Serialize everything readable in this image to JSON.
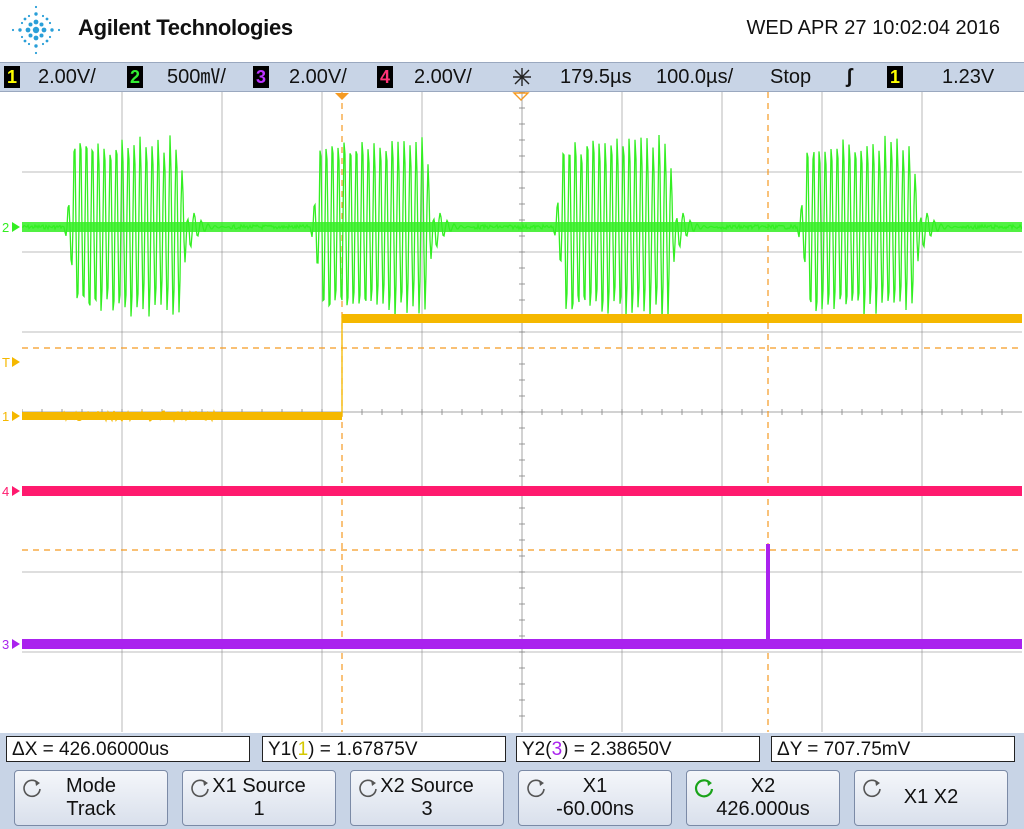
{
  "header": {
    "brand": "Agilent Technologies",
    "datetime": "WED APR 27 10:02:04 2016"
  },
  "status": {
    "ch1": {
      "num": "1",
      "scale": "2.00V/",
      "color": "#ffff00"
    },
    "ch2": {
      "num": "2",
      "scale": "500㎷/",
      "color": "#33ee33"
    },
    "ch3": {
      "num": "3",
      "scale": "2.00V/",
      "color": "#bb33ff"
    },
    "ch4": {
      "num": "4",
      "scale": "2.00V/",
      "color": "#ff3377"
    },
    "delay": "179.5µs",
    "timebase": "100.0µs/",
    "run_state": "Stop",
    "trigger_edge": "ʃ",
    "trigger_source": "1",
    "trigger_level": "1.23V"
  },
  "colors": {
    "ch1": "#f5b800",
    "ch2": "#33ee22",
    "ch3": "#aa22ee",
    "ch4": "#ff1a6e",
    "cursor": "#f59a22",
    "grid": "#808080"
  },
  "markers": {
    "ch1": "1",
    "ch2": "2",
    "ch3": "3",
    "ch4": "4",
    "trigger": "T"
  },
  "measurements": {
    "dx": "ΔX = 426.06000us",
    "y1_prefix": "Y1(",
    "y1_src": "1",
    "y1_suffix": ") = 1.67875V",
    "y2_prefix": "Y2(",
    "y2_src": "3",
    "y2_suffix": ") = 2.38650V",
    "dy": "ΔY = 707.75mV"
  },
  "softkeys": [
    {
      "line1": "Mode",
      "line2": "Track"
    },
    {
      "line1": "X1 Source",
      "line2": "1"
    },
    {
      "line1": "X2 Source",
      "line2": "3"
    },
    {
      "line1": "X1",
      "line2": "-60.00ns"
    },
    {
      "line1": "X2",
      "line2": "426.000us"
    },
    {
      "line1": "X1 X2",
      "line2": ""
    }
  ]
}
